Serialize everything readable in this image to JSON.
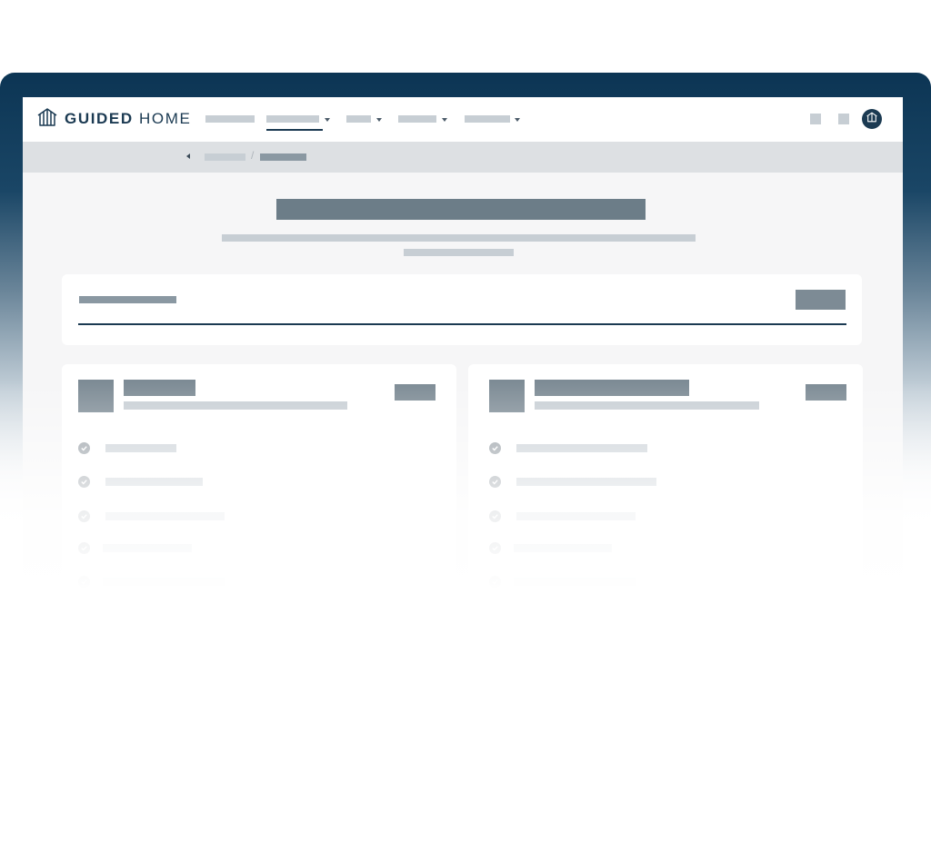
{
  "brand": {
    "name_bold": "GUIDED",
    "name_light": " HOME",
    "logo_icon": "house-outline-icon"
  },
  "nav": {
    "items": [
      {
        "has_dropdown": false,
        "active": false
      },
      {
        "has_dropdown": true,
        "active": true
      },
      {
        "has_dropdown": true,
        "active": false
      },
      {
        "has_dropdown": true,
        "active": false
      },
      {
        "has_dropdown": true,
        "active": false
      }
    ],
    "avatar_icon": "house-outline-icon"
  },
  "breadcrumb": {
    "back_icon": "triangle-left-icon",
    "separator": "/"
  },
  "colors": {
    "brand_navy": "#1b3a52",
    "frame_top": "#0c3554",
    "placeholder_dark": "#6c7d88",
    "placeholder_light": "#c7ced4",
    "check_gray": "#8f979e"
  },
  "cards": [
    {
      "checklist_items": 5,
      "check_icon": "checkmark-circle-icon"
    },
    {
      "checklist_items": 5,
      "check_icon": "checkmark-circle-icon"
    }
  ]
}
